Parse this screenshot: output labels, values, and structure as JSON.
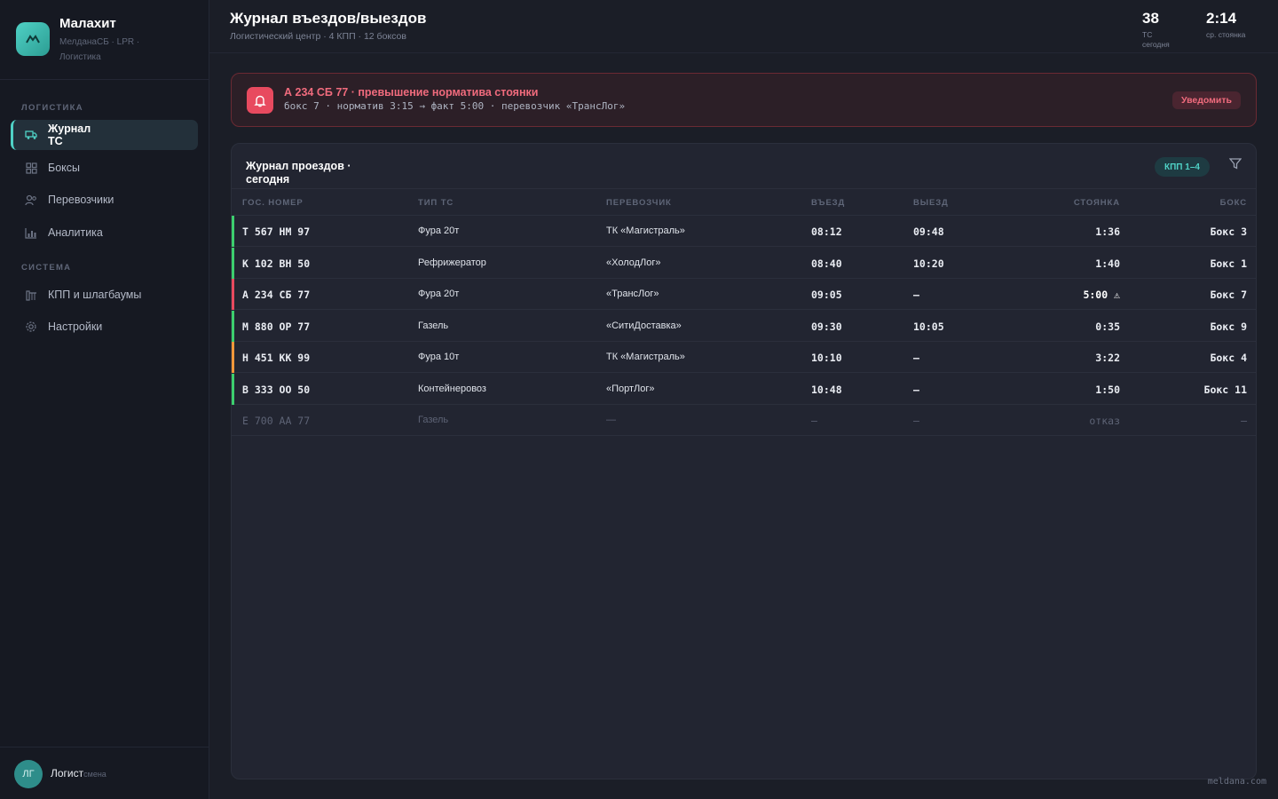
{
  "sidebar": {
    "brand_name": "Малахит",
    "brand_sub": "МелданаСБ · LPR · Логистика",
    "sections": [
      "ЛОГИСТИКА",
      "СИСТЕМА"
    ],
    "items": [
      {
        "label": "Журнал ТС",
        "icon": "truck-icon",
        "active": true
      },
      {
        "label": "Боксы",
        "icon": "grid-icon",
        "active": false
      },
      {
        "label": "Перевозчики",
        "icon": "users-icon",
        "active": false
      },
      {
        "label": "Аналитика",
        "icon": "chart-icon",
        "active": false
      },
      {
        "label": "КПП и шлагбаумы",
        "icon": "gate-icon",
        "active": false
      },
      {
        "label": "Настройки",
        "icon": "gear-icon",
        "active": false
      }
    ],
    "user": {
      "initials": "ЛГ",
      "name": "Логист",
      "role": "смена"
    }
  },
  "header": {
    "title": "Журнал въездов/выездов",
    "subtitle": "Логистический центр · 4 КПП · 12 боксов",
    "stats": [
      {
        "value": "38",
        "label": "ТС сегодня"
      },
      {
        "value": "2:14",
        "label": "ср. стоянка"
      }
    ]
  },
  "alert": {
    "title": "А 234 СБ 77 · превышение норматива стоянки",
    "detail": "бокс 7 · норматив 3:15 → факт 5:00 · перевозчик «ТрансЛог»",
    "action_label": "Уведомить",
    "color": "#e84a5f"
  },
  "table": {
    "title": "Журнал проездов · сегодня",
    "filter_chip": "КПП 1–4",
    "columns": [
      "ГОС. НОМЕР",
      "ТИП ТС",
      "ПЕРЕВОЗЧИК",
      "ВЪЕЗД",
      "ВЫЕЗД",
      "СТОЯНКА",
      "БОКС"
    ],
    "rows": [
      {
        "plate": "Т 567 НМ 97",
        "type": "Фура 20т",
        "carrier": "ТК «Магистраль»",
        "in": "08:12",
        "out": "09:48",
        "stay": "1:36",
        "box": "Бокс 3",
        "status_color": "#3ccf6e"
      },
      {
        "plate": "К 102 ВН 50",
        "type": "Рефрижератор",
        "carrier": "«ХолодЛог»",
        "in": "08:40",
        "out": "10:20",
        "stay": "1:40",
        "box": "Бокс 1",
        "status_color": "#3ccf6e"
      },
      {
        "plate": "А 234 СБ 77",
        "type": "Фура 20т",
        "carrier": "«ТрансЛог»",
        "in": "09:05",
        "out": "—",
        "stay": "5:00 ⚠",
        "box": "Бокс 7",
        "status_color": "#e84a5f"
      },
      {
        "plate": "М 880 ОР 77",
        "type": "Газель",
        "carrier": "«СитиДоставка»",
        "in": "09:30",
        "out": "10:05",
        "stay": "0:35",
        "box": "Бокс 9",
        "status_color": "#3ccf6e"
      },
      {
        "plate": "Н 451 КК 99",
        "type": "Фура 10т",
        "carrier": "ТК «Магистраль»",
        "in": "10:10",
        "out": "—",
        "stay": "3:22",
        "box": "Бокс 4",
        "status_color": "#f0973a"
      },
      {
        "plate": "В 333 ОО 50",
        "type": "Контейнеровоз",
        "carrier": "«ПортЛог»",
        "in": "10:48",
        "out": "—",
        "stay": "1:50",
        "box": "Бокс 11",
        "status_color": "#3ccf6e"
      },
      {
        "plate": "Е 700 АА 77",
        "type": "Газель",
        "carrier": "—",
        "in": "—",
        "out": "—",
        "stay": "отказ",
        "box": "—",
        "status_color": "",
        "muted": true
      }
    ]
  },
  "footer_mark": "meldana.com",
  "accent_color": "#4fd1c5"
}
